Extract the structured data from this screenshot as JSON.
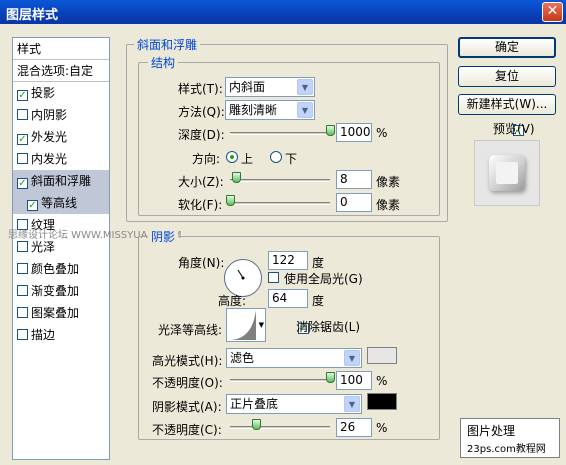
{
  "window": {
    "title": "图层样式",
    "close_glyph": "✕"
  },
  "left_panel": {
    "items": [
      {
        "label": "样式",
        "type": "header"
      },
      {
        "label": "混合选项:自定",
        "type": "header"
      },
      {
        "label": "投影",
        "checked": true
      },
      {
        "label": "内阴影",
        "checked": false
      },
      {
        "label": "外发光",
        "checked": true
      },
      {
        "label": "内发光",
        "checked": false
      },
      {
        "label": "斜面和浮雕",
        "checked": true,
        "selected": true
      },
      {
        "label": "等高线",
        "checked": true,
        "selected": true
      },
      {
        "label": "纹理",
        "checked": false
      },
      {
        "label": "光泽",
        "checked": false
      },
      {
        "label": "颜色叠加",
        "checked": false
      },
      {
        "label": "渐变叠加",
        "checked": false
      },
      {
        "label": "图案叠加",
        "checked": false
      },
      {
        "label": "描边",
        "checked": false
      }
    ]
  },
  "bevel": {
    "section_title": "斜面和浮雕",
    "structure_title": "结构",
    "style_label": "样式(T):",
    "style_value": "内斜面",
    "technique_label": "方法(Q):",
    "technique_value": "雕刻清晰",
    "depth_label": "深度(D):",
    "depth_value": "1000",
    "depth_unit": "%",
    "depth_level": 1.0,
    "direction_label": "方向:",
    "direction_up": "上",
    "direction_down": "下",
    "size_label": "大小(Z):",
    "size_value": "8",
    "size_unit": "像素",
    "size_level": 0.033,
    "soften_label": "软化(F):",
    "soften_value": "0",
    "soften_unit": "像素",
    "soften_level": 0.0
  },
  "shading": {
    "title": "阴影",
    "angle_label": "角度(N):",
    "angle_value": "122",
    "angle_unit": "度",
    "global_light_label": "使用全局光(G)",
    "altitude_label": "高度:",
    "altitude_value": "64",
    "altitude_unit": "度",
    "gloss_label": "光泽等高线:",
    "antialias_label": "消除锯齿(L)",
    "highlight_mode_label": "高光模式(H):",
    "highlight_mode_value": "滤色",
    "highlight_color": "#e6e6e6",
    "highlight_opacity_label": "不透明度(O):",
    "highlight_opacity_value": "100",
    "highlight_opacity_level": 1.0,
    "shadow_mode_label": "阴影模式(A):",
    "shadow_mode_value": "正片叠底",
    "shadow_color": "#000000",
    "shadow_opacity_label": "不透明度(C):",
    "shadow_opacity_value": "26",
    "shadow_opacity_level": 0.26,
    "percent": "%"
  },
  "buttons": {
    "ok": "确定",
    "reset": "复位",
    "new_style": "新建样式(W)...",
    "preview_label": "预览(V)"
  },
  "watermarks": {
    "mid": "思缘设计论坛  WWW.MISSYUAN.COM",
    "logo_line1": "图片处理",
    "logo_line2": "23ps.com教程网"
  }
}
